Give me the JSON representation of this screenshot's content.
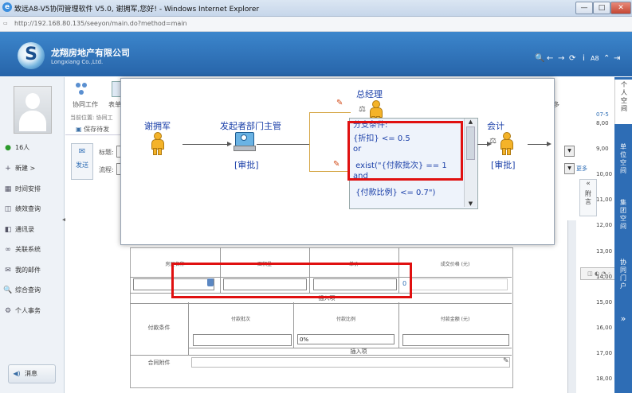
{
  "window": {
    "title": "致远A8-V5协同管理软件 V5.0, 谢拥军,您好! - Windows Internet Explorer",
    "address": "http://192.168.80.135/seeyon/main.do?method=main",
    "buttons": {
      "minimize": "—",
      "maximize": "□",
      "close": "✕"
    }
  },
  "header": {
    "company": "龙翔房地产有限公司",
    "company_en": "Longxiang Co.,Ltd.",
    "tool_icons": [
      "search-icon",
      "back-icon",
      "forward-icon",
      "refresh-icon",
      "info-icon",
      "font-size-icon",
      "collapse-icon",
      "logout-icon"
    ],
    "tool_glyphs": [
      "🔍",
      "←",
      "→",
      "⟳",
      "i",
      "A8",
      "⌃",
      "⇥"
    ]
  },
  "sidebar": {
    "online": "16人",
    "items": [
      {
        "icon": "+",
        "label": "新建 >"
      },
      {
        "icon": "▦",
        "label": "时间安排"
      },
      {
        "icon": "◫",
        "label": "绩效查询"
      },
      {
        "icon": "◧",
        "label": "通讯录"
      },
      {
        "icon": "∞",
        "label": "关联系统"
      },
      {
        "icon": "✉",
        "label": "我的邮件"
      },
      {
        "icon": "🔍",
        "label": "综合查询"
      },
      {
        "icon": "⚙",
        "label": "个人事务"
      }
    ],
    "message": "消息"
  },
  "toolbar": {
    "collab": "协同工作",
    "form": "表单",
    "more": "多",
    "location": "当前位置:  协同工",
    "save_draft": "保存待发",
    "send": "发送",
    "subject_label": "标题:",
    "flow_label": "流程:"
  },
  "form": {
    "headers": [
      "房屋名称",
      "面积量",
      "单价",
      "成交价格 (元)"
    ],
    "row_value": "0",
    "insert": "插入项",
    "payment_label": "付款条件",
    "payment_headers": [
      "付款批次",
      "付款比例",
      "付款金额 (元)"
    ],
    "payment_ratio": "0%",
    "attach_label": "合同附件",
    "more_link": "更多"
  },
  "attachments_panel": {
    "collapse": "«",
    "label": "附言"
  },
  "timeline": {
    "date": "07-5",
    "times": [
      "8,00",
      "9,00",
      "10,00",
      "11,00",
      "12,00",
      "13,00",
      "14,00",
      "15,00",
      "16,00",
      "17,00",
      "18,00"
    ]
  },
  "rail": {
    "items": [
      "个人空间",
      "单位空间",
      "集团空间",
      "协同门户"
    ],
    "expand": "»"
  },
  "popup": {
    "nodes": {
      "start": "谢拥军",
      "dept": "发起者部门主管",
      "dept_action": "[审批]",
      "manager": "总经理",
      "accountant": "会计",
      "accountant_action": "[审批]"
    },
    "condition_lines": [
      "分支条件:",
      "{折扣} <= 0.5",
      "or",
      " exist(\"{付款批次} == 1",
      "and",
      " {付款比例} <= 0.7\")"
    ]
  },
  "colors": {
    "accent": "#2e6db5",
    "highlight": "#e01010",
    "node_text": "#1a3fa8"
  }
}
